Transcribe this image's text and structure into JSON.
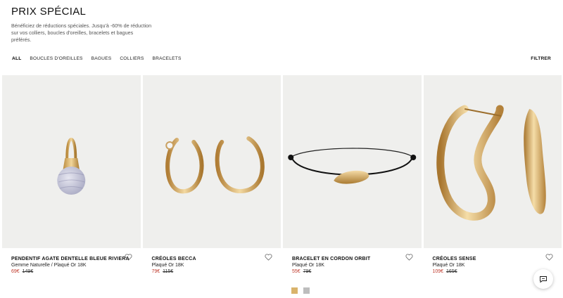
{
  "header": {
    "title": "PRIX SPÉCIAL",
    "description": "Bénéficiez de réductions spéciales. Jusqu'à -60% de réduction sur vos colliers, boucles d'oreilles, bracelets et bagues préférés."
  },
  "filters": {
    "items": [
      "ALL",
      "BOUCLES D'OREILLES",
      "BAGUES",
      "COLLIERS",
      "BRACELETS"
    ],
    "active": "ALL",
    "filter_button": "FILTRER"
  },
  "products": [
    {
      "name": "PENDENTIF AGATE DENTELLE BLEUE RIVIERA",
      "subtitle": "Gemme Naturelle / Plaqué Or 18K",
      "price": "69€",
      "old_price": "149€"
    },
    {
      "name": "CRÉOLES BECCA",
      "subtitle": "Plaqué Or 18K",
      "price": "79€",
      "old_price": "115€"
    },
    {
      "name": "BRACELET EN CORDON ORBIT",
      "subtitle": "Plaqué Or 18K",
      "price": "55€",
      "old_price": "79€"
    },
    {
      "name": "CRÉOLES SENSE",
      "subtitle": "Plaqué Or 18K",
      "price": "109€",
      "old_price": "165€"
    }
  ],
  "swatches": {
    "gold": "#d9b36b",
    "silver": "#bdbdbd"
  },
  "colors": {
    "sale": "#c0392b",
    "image_bg": "#efefed",
    "gold": "#d8b070"
  },
  "icons": {
    "heart": "heart-icon",
    "chat": "chat-icon"
  }
}
